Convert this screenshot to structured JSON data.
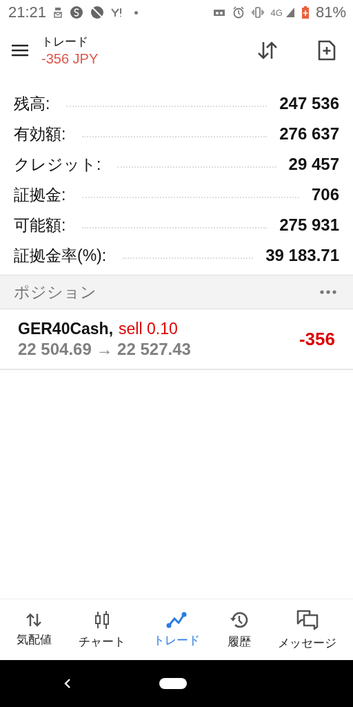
{
  "status_bar": {
    "time": "21:21",
    "network": "4G",
    "battery": "81%"
  },
  "header": {
    "title": "トレード",
    "subtitle": "-356 JPY"
  },
  "account": [
    {
      "label": "残高:",
      "value": "247 536"
    },
    {
      "label": "有効額:",
      "value": "276 637"
    },
    {
      "label": "クレジット:",
      "value": "29 457"
    },
    {
      "label": "証拠金:",
      "value": "706"
    },
    {
      "label": "可能額:",
      "value": "275 931"
    },
    {
      "label": "証拠金率(%):",
      "value": "39 183.71"
    }
  ],
  "positions": {
    "title": "ポジション",
    "items": [
      {
        "symbol": "GER40Cash,",
        "order": "sell 0.10",
        "prices": "22 504.69 → 22 527.43",
        "profit": "-356"
      }
    ]
  },
  "bottom_nav": [
    {
      "label": "気配値",
      "selected": false
    },
    {
      "label": "チャート",
      "selected": false
    },
    {
      "label": "トレード",
      "selected": true
    },
    {
      "label": "履歴",
      "selected": false
    },
    {
      "label": "メッセージ",
      "selected": false
    }
  ]
}
